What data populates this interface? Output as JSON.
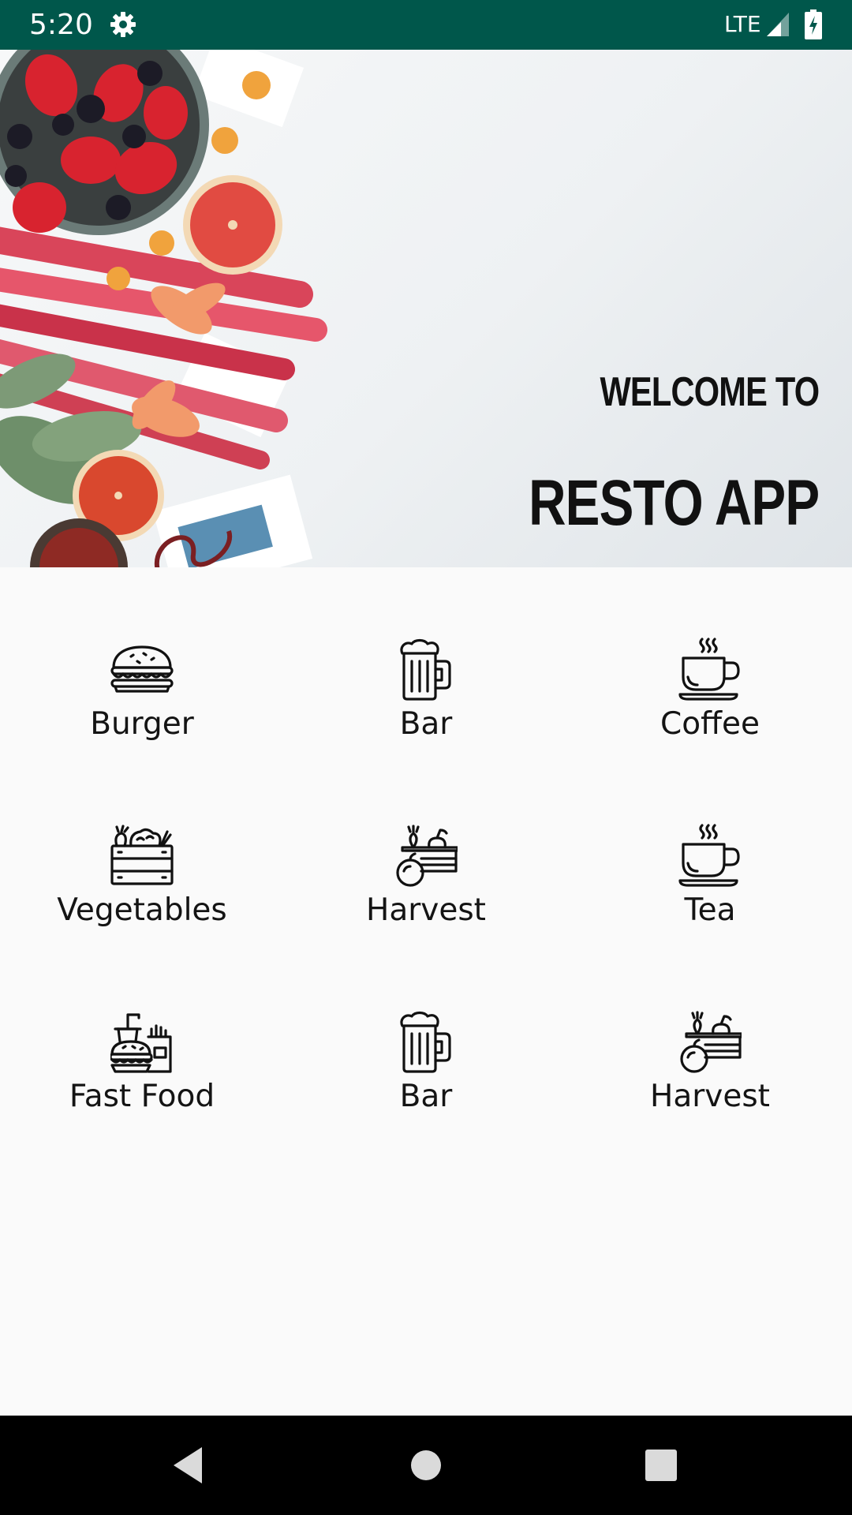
{
  "status_bar": {
    "time": "5:20",
    "network": "LTE",
    "settings_icon": "gear-icon",
    "signal_icon": "signal-icon",
    "battery_icon": "battery-charging-icon",
    "background_color": "#00574b"
  },
  "hero": {
    "welcome": "WELCOME TO",
    "app_name": "RESTO APP",
    "image": "fruit-flatlay-image"
  },
  "categories": [
    {
      "label": "Burger",
      "icon": "burger-icon"
    },
    {
      "label": "Bar",
      "icon": "beer-mug-icon"
    },
    {
      "label": "Coffee",
      "icon": "coffee-cup-icon"
    },
    {
      "label": "Vegetables",
      "icon": "vegetable-crate-icon"
    },
    {
      "label": "Harvest",
      "icon": "harvest-basket-icon"
    },
    {
      "label": "Tea",
      "icon": "tea-cup-icon"
    },
    {
      "label": "Fast Food",
      "icon": "fast-food-icon"
    },
    {
      "label": "Bar",
      "icon": "beer-mug-icon"
    },
    {
      "label": "Harvest",
      "icon": "harvest-basket-icon"
    }
  ],
  "nav_bar": {
    "back_icon": "back-triangle-icon",
    "home_icon": "home-circle-icon",
    "recents_icon": "recents-square-icon"
  }
}
